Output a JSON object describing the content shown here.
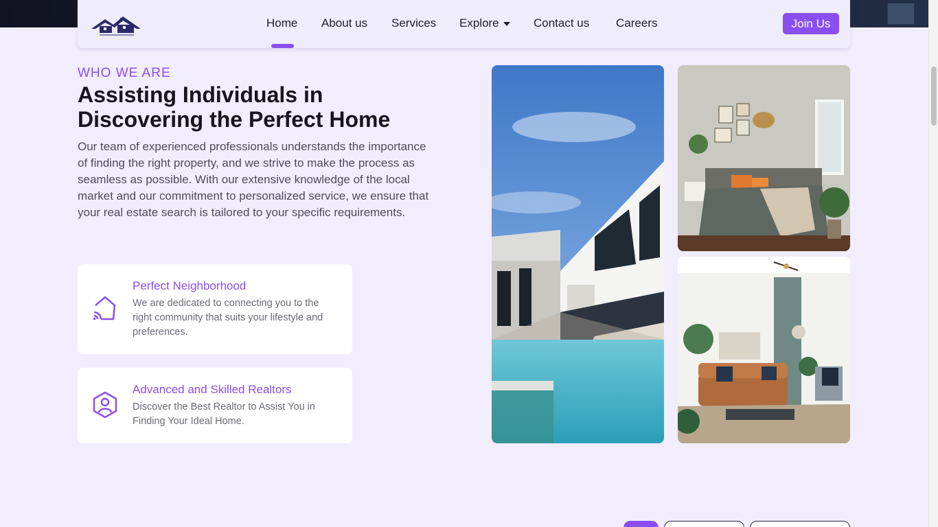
{
  "nav": {
    "items": [
      {
        "label": "Home",
        "active": true
      },
      {
        "label": "About us"
      },
      {
        "label": "Services"
      },
      {
        "label": "Explore"
      },
      {
        "label": "Contact us"
      },
      {
        "label": "Careers"
      }
    ],
    "join_label": "Join Us"
  },
  "intro": {
    "eyebrow": "WHO WE ARE",
    "title": "Assisting Individuals in Discovering the Perfect Home",
    "body": "Our team of experienced professionals understands the importance of finding the right property, and we strive to make the process as seamless as possible. With our extensive knowledge of the local market and our commitment to personalized service, we ensure that your real estate search is tailored to your specific requirements."
  },
  "features": [
    {
      "title": "Perfect Neighborhood",
      "desc": "We are dedicated to connecting you to the right community that suits your lifestyle and preferences.",
      "icon": "home-signal-icon"
    },
    {
      "title": "Advanced and Skilled Realtors",
      "desc": "Discover the Best Realtor to Assist You in Finding Your Ideal Home.",
      "icon": "user-badge-icon"
    }
  ],
  "colors": {
    "accent": "#8a4ef0",
    "background": "#f1edfc",
    "heading": "#16141f"
  }
}
